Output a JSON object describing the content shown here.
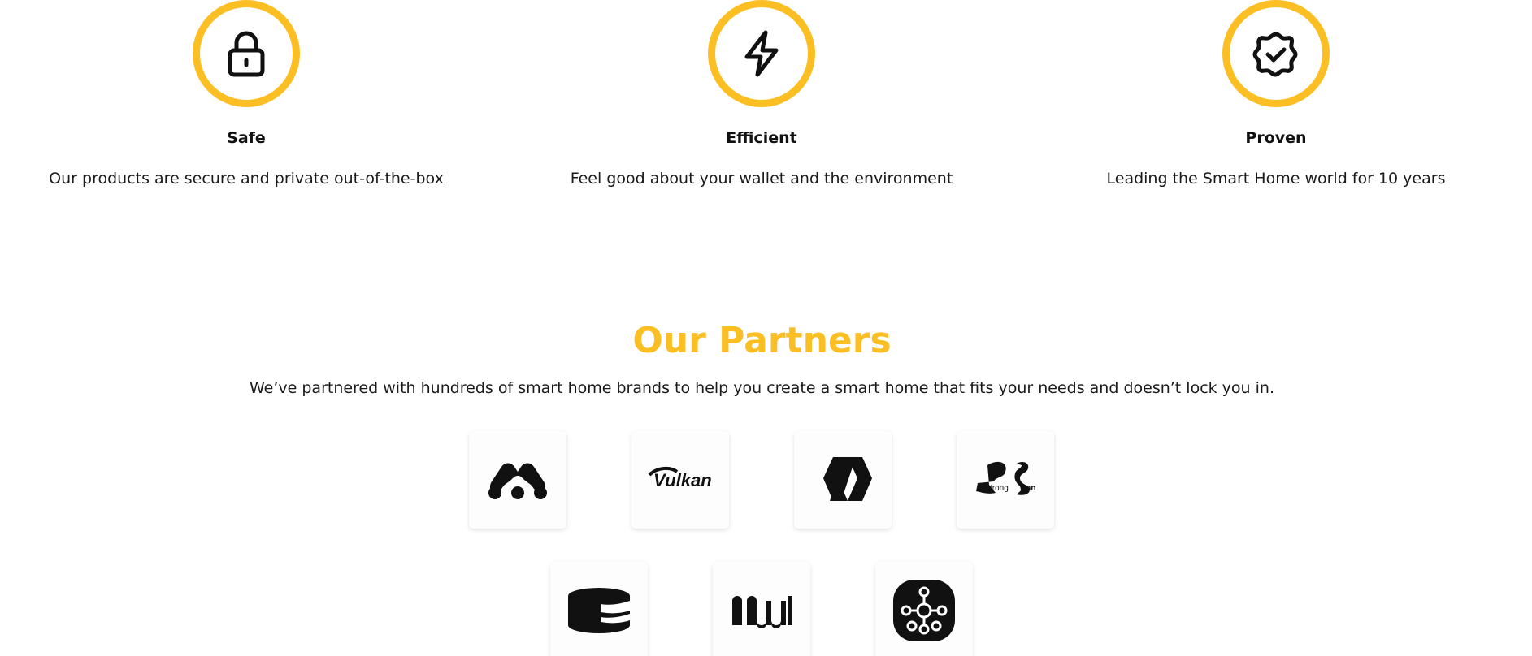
{
  "features": [
    {
      "icon": "lock-icon",
      "title": "Safe",
      "description": "Our products are secure and private out-of-the-box"
    },
    {
      "icon": "lightning-bolt-icon",
      "title": "Efficient",
      "description": "Feel good about your wallet and the environment"
    },
    {
      "icon": "badge-check-icon",
      "title": "Proven",
      "description": "Leading the Smart Home world for 10 years"
    }
  ],
  "partners": {
    "title": "Our Partners",
    "subtitle": "We’ve partnered with hundreds of smart home brands to help you create a smart home that fits your needs and doesn’t lock you in.",
    "logos_row1": [
      {
        "icon": "mendeley-logo-icon"
      },
      {
        "icon": "vulkan-logo-icon",
        "text": "Vulkan"
      },
      {
        "icon": "polymer-logo-icon"
      },
      {
        "icon": "strongswan-logo-icon",
        "text_left": "strong",
        "text_right": "wan"
      }
    ],
    "logos_row2": [
      {
        "icon": "cakephp-logo-icon"
      },
      {
        "icon": "muni-logo-icon"
      },
      {
        "icon": "smartthings-logo-icon"
      }
    ]
  },
  "colors": {
    "accent": "#FBBF24",
    "text": "#111111",
    "background": "#ffffff"
  }
}
